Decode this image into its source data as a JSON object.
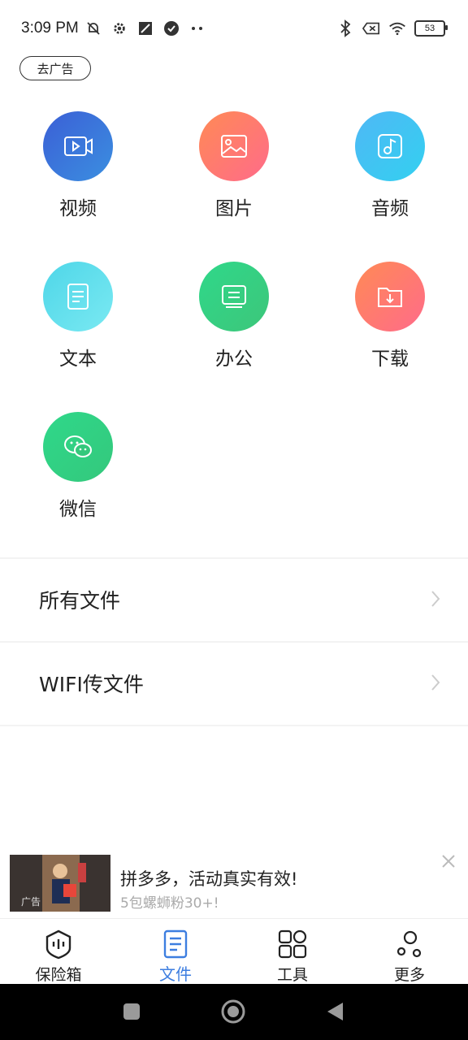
{
  "status_bar": {
    "time": "3:09 PM",
    "battery": "53"
  },
  "ad_pill": "去广告",
  "categories": [
    {
      "label": "视频",
      "icon": "video-icon",
      "gradient": [
        "#3b5fd6",
        "#3b8fe0"
      ]
    },
    {
      "label": "图片",
      "icon": "image-icon",
      "gradient": [
        "#ff8a55",
        "#ff6b8a"
      ]
    },
    {
      "label": "音频",
      "icon": "music-icon",
      "gradient": [
        "#4fb8f5",
        "#33d0f0"
      ]
    },
    {
      "label": "文本",
      "icon": "document-icon",
      "gradient": [
        "#4ed6e8",
        "#7ae9f2"
      ]
    },
    {
      "label": "办公",
      "icon": "office-icon",
      "gradient": [
        "#2fd88a",
        "#3dc67a"
      ]
    },
    {
      "label": "下载",
      "icon": "download-icon",
      "gradient": [
        "#ff8a55",
        "#ff6b8a"
      ]
    },
    {
      "label": "微信",
      "icon": "wechat-icon",
      "gradient": [
        "#2fd88a",
        "#34c87c"
      ]
    }
  ],
  "rows": [
    {
      "label": "所有文件"
    },
    {
      "label": "WIFI传文件"
    }
  ],
  "ad_banner": {
    "title": "拼多多，活动真实有效!",
    "subtitle": "5包螺蛳粉30+!",
    "tag": "广告"
  },
  "bottom_nav": [
    {
      "label": "保险箱",
      "icon": "safe-icon",
      "active": false
    },
    {
      "label": "文件",
      "icon": "file-icon",
      "active": true
    },
    {
      "label": "工具",
      "icon": "tools-icon",
      "active": false
    },
    {
      "label": "更多",
      "icon": "more-icon",
      "active": false
    }
  ],
  "colors": {
    "accent": "#3d7ee0"
  }
}
